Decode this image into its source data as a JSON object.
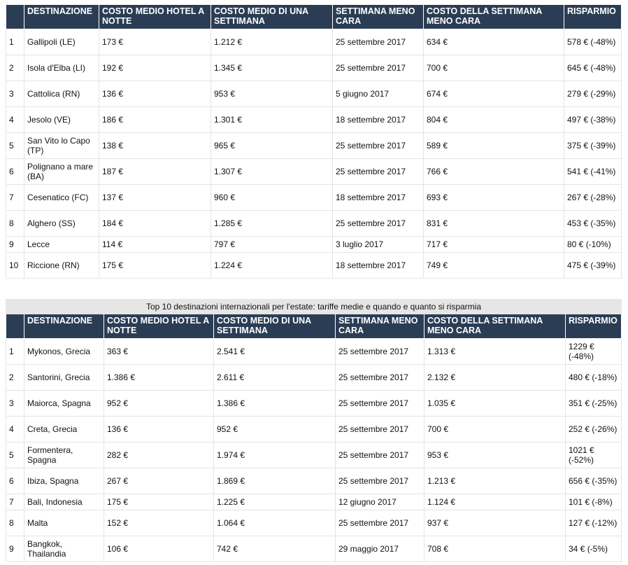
{
  "domestic": {
    "headers": [
      "",
      "DESTINAZIONE",
      "COSTO MEDIO HOTEL A NOTTE",
      "COSTO MEDIO DI UNA SETTIMANA",
      "SETTIMANA MENO CARA",
      "COSTO DELLA SETTIMANA MENO CARA",
      "RISPARMIO"
    ],
    "rows": [
      [
        "1",
        "Gallipoli (LE)",
        "173 €",
        "1.212 €",
        "25 settembre 2017",
        "634 €",
        "578 € (-48%)"
      ],
      [
        "2",
        "Isola d'Elba (LI)",
        "192 €",
        "1.345 €",
        "25 settembre 2017",
        "700 €",
        "645 € (-48%)"
      ],
      [
        "3",
        "Cattolica (RN)",
        "136 €",
        "953 €",
        "5 giugno 2017",
        "674 €",
        "279 € (-29%)"
      ],
      [
        "4",
        "Jesolo (VE)",
        "186 €",
        "1.301 €",
        "18 settembre 2017",
        "804 €",
        "497 € (-38%)"
      ],
      [
        "5",
        "San Vito lo Capo (TP)",
        "138 €",
        "965 €",
        "25 settembre 2017",
        "589 €",
        "375 € (-39%)"
      ],
      [
        "6",
        "Polignano a mare (BA)",
        "187 €",
        "1.307 €",
        "25 settembre 2017",
        "766 €",
        "541 € (-41%)"
      ],
      [
        "7",
        "Cesenatico (FC)",
        "137 €",
        "960 €",
        "18 settembre 2017",
        "693 €",
        "267 € (-28%)"
      ],
      [
        "8",
        "Alghero (SS)",
        "184 €",
        "1.285 €",
        "25 settembre 2017",
        "831 €",
        "453 € (-35%)"
      ],
      [
        "9",
        "Lecce",
        "114 €",
        "797 €",
        "3 luglio 2017",
        "717 €",
        "80 € (-10%)"
      ],
      [
        "10",
        "Riccione (RN)",
        "175 €",
        "1.224 €",
        "18 settembre 2017",
        "749 €",
        "475 € (-39%)"
      ]
    ],
    "short_rows": [
      8
    ]
  },
  "international": {
    "caption": "Top 10 destinazioni internazionali per l'estate: tariffe medie e quando e quanto si risparmia",
    "headers": [
      "",
      "DESTINAZIONE",
      "COSTO MEDIO HOTEL A NOTTE",
      "COSTO MEDIO DI UNA SETTIMANA",
      "SETTIMANA MENO CARA",
      "COSTO DELLA SETTIMANA MENO CARA",
      "RISPARMIO"
    ],
    "rows": [
      [
        "1",
        "Mykonos, Grecia",
        "363 €",
        "2.541 €",
        "25 settembre 2017",
        "1.313 €",
        "1229 € (-48%)"
      ],
      [
        "2",
        "Santorini, Grecia",
        "1.386 €",
        "2.611 €",
        "25 settembre 2017",
        "2.132 €",
        "480 € (-18%)"
      ],
      [
        "3",
        "Maiorca, Spagna",
        "952 €",
        "1.386 €",
        "25 settembre 2017",
        "1.035 €",
        "351 € (-25%)"
      ],
      [
        "4",
        "Creta, Grecia",
        "136 €",
        "952 €",
        "25 settembre 2017",
        "700 €",
        "252 € (-26%)"
      ],
      [
        "5",
        "Formentera, Spagna",
        "282 €",
        "1.974 €",
        "25 settembre 2017",
        "953 €",
        "1021 € (-52%)"
      ],
      [
        "6",
        "Ibiza, Spagna",
        "267 €",
        "1.869 €",
        "25 settembre 2017",
        "1.213 €",
        "656 € (-35%)"
      ],
      [
        "7",
        "Bali, Indonesia",
        "175 €",
        "1.225 €",
        "12 giugno 2017",
        "1.124 €",
        "101 € (-8%)"
      ],
      [
        "8",
        "Malta",
        "152 €",
        "1.064 €",
        "25 settembre 2017",
        "937 €",
        "127 € (-12%)"
      ],
      [
        "9",
        "Bangkok, Thailandia",
        "106 €",
        "742 €",
        "29 maggio 2017",
        "708 €",
        "34 € (-5%)"
      ]
    ],
    "short_rows": [
      6
    ]
  }
}
